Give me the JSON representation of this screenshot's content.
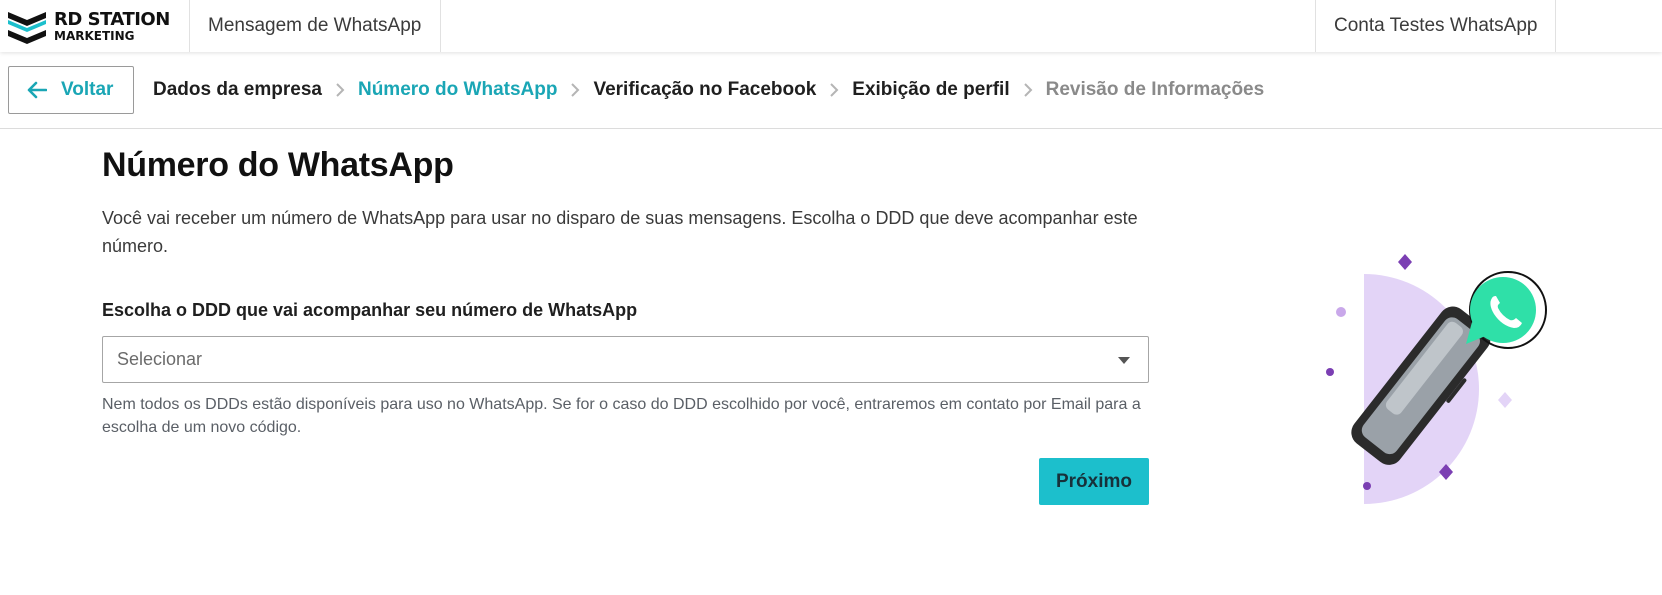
{
  "header": {
    "brand_line1": "RD STATION",
    "brand_line2": "MARKETING",
    "app_title": "Mensagem de WhatsApp",
    "account_name": "Conta Testes WhatsApp"
  },
  "stepper": {
    "back_label": "Voltar",
    "steps": [
      {
        "label": "Dados da empresa",
        "state": "done"
      },
      {
        "label": "Número do WhatsApp",
        "state": "current"
      },
      {
        "label": "Verificação no Facebook",
        "state": "done"
      },
      {
        "label": "Exibição de perfil",
        "state": "done"
      },
      {
        "label": "Revisão de Informações",
        "state": "todo"
      }
    ]
  },
  "main": {
    "title": "Número do WhatsApp",
    "description": "Você vai receber um número de WhatsApp para usar no disparo de suas mensagens. Escolha o DDD que deve acompanhar este número.",
    "ddd_label": "Escolha o DDD que vai acompanhar seu número de WhatsApp",
    "ddd_placeholder": "Selecionar",
    "help_text": "Nem todos os DDDs estão disponíveis para uso no WhatsApp. Se for o caso do DDD escolhido por você, entraremos em contato por Email para a escolha de um novo código.",
    "next_label": "Próximo"
  },
  "icons": {
    "brand": "rd-station-logo-icon",
    "back": "arrow-left-icon",
    "step_separator": "chevron-right-icon",
    "select_caret": "caret-down-icon",
    "illustration": "whatsapp-phone-illustration"
  },
  "colors": {
    "accent": "#1aa6b5",
    "primary_button": "#1cbfcc",
    "illustration_purple": "#7b3fb3",
    "illustration_lilac": "#e3d4f7",
    "whatsapp_green": "#2fe0a8"
  }
}
